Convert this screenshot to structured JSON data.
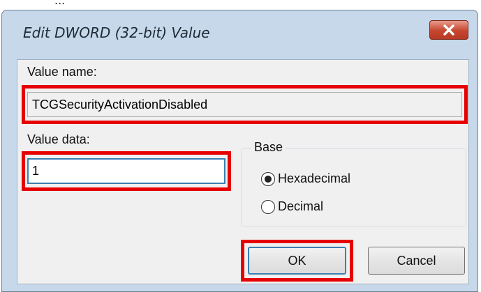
{
  "window": {
    "title": "Edit DWORD (32-bit) Value"
  },
  "background_fragment": "...",
  "value_name": {
    "label": "Value name:",
    "value": "TCGSecurityActivationDisabled"
  },
  "value_data": {
    "label": "Value data:",
    "value": "1"
  },
  "base": {
    "legend": "Base",
    "options": [
      {
        "label": "Hexadecimal",
        "selected": true
      },
      {
        "label": "Decimal",
        "selected": false
      }
    ]
  },
  "buttons": {
    "ok": "OK",
    "cancel": "Cancel"
  },
  "colors": {
    "highlight": "#e60000",
    "title_bar": "#c6d8ea",
    "client": "#f0f0f0",
    "close_button": "#c6452e",
    "focus_border": "#3c7fb1"
  },
  "icons": {
    "close": "close-x-icon",
    "radio_selected": "radio-selected-icon",
    "radio_unselected": "radio-unselected-icon"
  }
}
